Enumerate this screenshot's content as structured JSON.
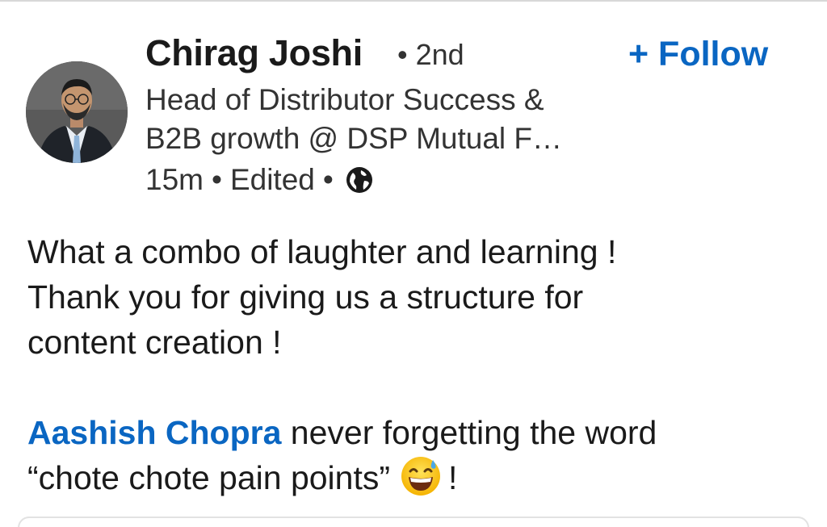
{
  "post": {
    "author": {
      "name": "Chirag Joshi",
      "connection_degree": "• 2nd",
      "headline_line1": "Head of Distributor Success &",
      "headline_line2": "B2B growth @ DSP Mutual F…",
      "timestamp": "15m",
      "edited_label": "Edited",
      "separator": "•",
      "visibility_icon": "globe-icon"
    },
    "follow_label": "+ Follow",
    "body": {
      "line1": "What a combo of laughter and learning !",
      "line2": "Thank you for giving us a structure for",
      "line3": "content creation !",
      "mention": "Aashish Chopra",
      "line4_rest": " never forgetting the word",
      "line5": "“chote chote pain points”",
      "emoji": "grinning-face-with-sweat-emoji",
      "line5_end": "!"
    }
  },
  "colors": {
    "link_blue": "#0a66c2",
    "text_primary": "#1a1a1a",
    "text_secondary": "#333333"
  }
}
